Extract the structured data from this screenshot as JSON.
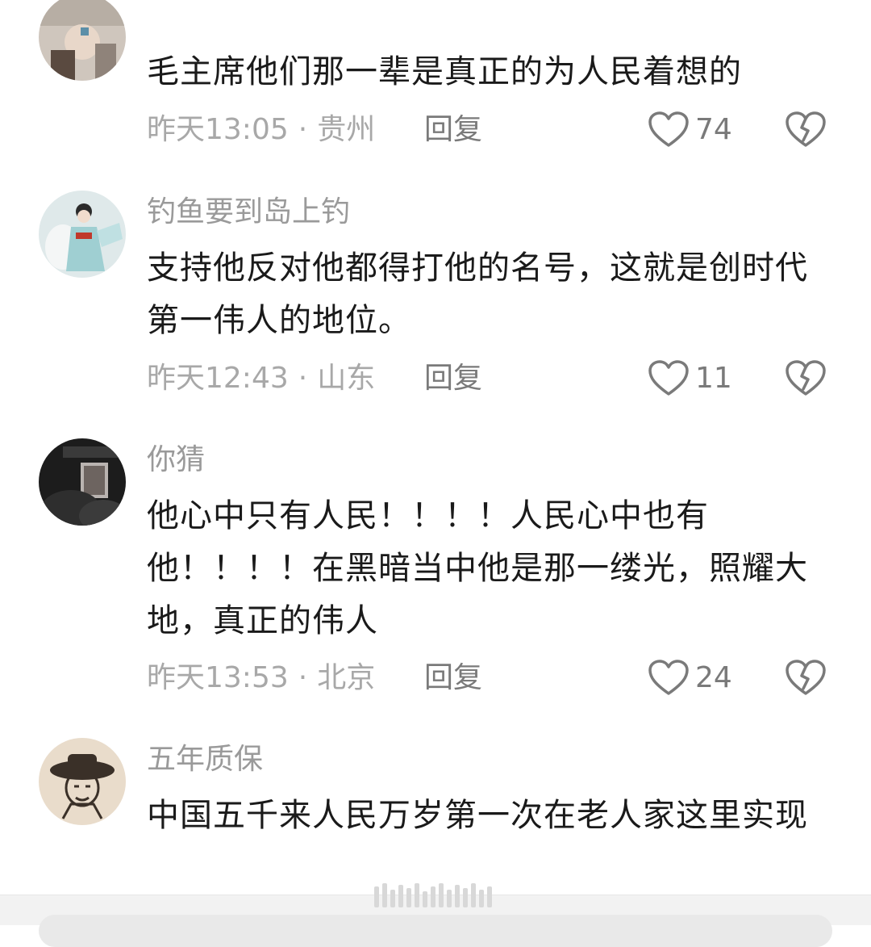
{
  "comments": [
    {
      "username": "",
      "text": "毛主席他们那一辈是真正的为人民着想的",
      "time": "昨天13:05",
      "location": "贵州",
      "reply_label": "回复",
      "likes": "74",
      "avatar_icon": "user-avatar-photo"
    },
    {
      "username": "钓鱼要到岛上钓",
      "text": "支持他反对他都得打他的名号，这就是创时代第一伟人的地位。",
      "time": "昨天12:43",
      "location": "山东",
      "reply_label": "回复",
      "likes": "11",
      "avatar_icon": "user-avatar-illustration"
    },
    {
      "username": "你猜",
      "text": "他心中只有人民！！！！人民心中也有他！！！！在黑暗当中他是那一缕光，照耀大地，真正的伟人",
      "time": "昨天13:53",
      "location": "北京",
      "reply_label": "回复",
      "likes": "24",
      "avatar_icon": "user-avatar-photo"
    },
    {
      "username": "五年质保",
      "text": "中国五千来人民万岁第一次在老人家这里实现",
      "avatar_icon": "user-avatar-sketch"
    }
  ],
  "meta_separator": "·",
  "colors": {
    "text_primary": "#1a1a1a",
    "text_secondary": "#9a9a9a",
    "icon_gray": "#7a7a7a",
    "background": "#ffffff"
  }
}
